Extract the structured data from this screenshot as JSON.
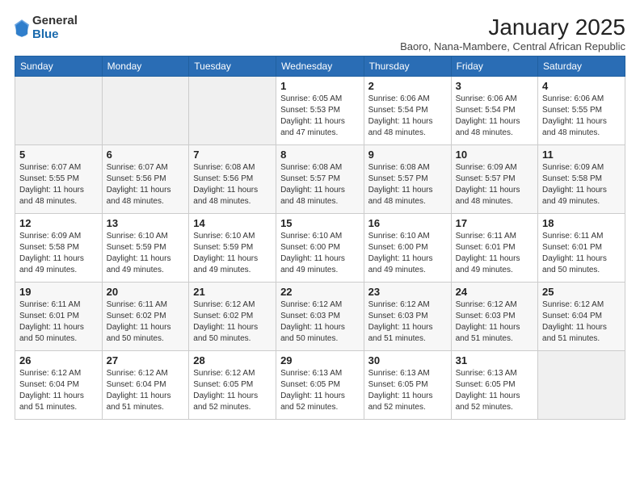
{
  "header": {
    "logo_general": "General",
    "logo_blue": "Blue",
    "month_title": "January 2025",
    "subtitle": "Baoro, Nana-Mambere, Central African Republic"
  },
  "days_of_week": [
    "Sunday",
    "Monday",
    "Tuesday",
    "Wednesday",
    "Thursday",
    "Friday",
    "Saturday"
  ],
  "weeks": [
    [
      {
        "day": "",
        "info": ""
      },
      {
        "day": "",
        "info": ""
      },
      {
        "day": "",
        "info": ""
      },
      {
        "day": "1",
        "info": "Sunrise: 6:05 AM\nSunset: 5:53 PM\nDaylight: 11 hours and 47 minutes."
      },
      {
        "day": "2",
        "info": "Sunrise: 6:06 AM\nSunset: 5:54 PM\nDaylight: 11 hours and 48 minutes."
      },
      {
        "day": "3",
        "info": "Sunrise: 6:06 AM\nSunset: 5:54 PM\nDaylight: 11 hours and 48 minutes."
      },
      {
        "day": "4",
        "info": "Sunrise: 6:06 AM\nSunset: 5:55 PM\nDaylight: 11 hours and 48 minutes."
      }
    ],
    [
      {
        "day": "5",
        "info": "Sunrise: 6:07 AM\nSunset: 5:55 PM\nDaylight: 11 hours and 48 minutes."
      },
      {
        "day": "6",
        "info": "Sunrise: 6:07 AM\nSunset: 5:56 PM\nDaylight: 11 hours and 48 minutes."
      },
      {
        "day": "7",
        "info": "Sunrise: 6:08 AM\nSunset: 5:56 PM\nDaylight: 11 hours and 48 minutes."
      },
      {
        "day": "8",
        "info": "Sunrise: 6:08 AM\nSunset: 5:57 PM\nDaylight: 11 hours and 48 minutes."
      },
      {
        "day": "9",
        "info": "Sunrise: 6:08 AM\nSunset: 5:57 PM\nDaylight: 11 hours and 48 minutes."
      },
      {
        "day": "10",
        "info": "Sunrise: 6:09 AM\nSunset: 5:57 PM\nDaylight: 11 hours and 48 minutes."
      },
      {
        "day": "11",
        "info": "Sunrise: 6:09 AM\nSunset: 5:58 PM\nDaylight: 11 hours and 49 minutes."
      }
    ],
    [
      {
        "day": "12",
        "info": "Sunrise: 6:09 AM\nSunset: 5:58 PM\nDaylight: 11 hours and 49 minutes."
      },
      {
        "day": "13",
        "info": "Sunrise: 6:10 AM\nSunset: 5:59 PM\nDaylight: 11 hours and 49 minutes."
      },
      {
        "day": "14",
        "info": "Sunrise: 6:10 AM\nSunset: 5:59 PM\nDaylight: 11 hours and 49 minutes."
      },
      {
        "day": "15",
        "info": "Sunrise: 6:10 AM\nSunset: 6:00 PM\nDaylight: 11 hours and 49 minutes."
      },
      {
        "day": "16",
        "info": "Sunrise: 6:10 AM\nSunset: 6:00 PM\nDaylight: 11 hours and 49 minutes."
      },
      {
        "day": "17",
        "info": "Sunrise: 6:11 AM\nSunset: 6:01 PM\nDaylight: 11 hours and 49 minutes."
      },
      {
        "day": "18",
        "info": "Sunrise: 6:11 AM\nSunset: 6:01 PM\nDaylight: 11 hours and 50 minutes."
      }
    ],
    [
      {
        "day": "19",
        "info": "Sunrise: 6:11 AM\nSunset: 6:01 PM\nDaylight: 11 hours and 50 minutes."
      },
      {
        "day": "20",
        "info": "Sunrise: 6:11 AM\nSunset: 6:02 PM\nDaylight: 11 hours and 50 minutes."
      },
      {
        "day": "21",
        "info": "Sunrise: 6:12 AM\nSunset: 6:02 PM\nDaylight: 11 hours and 50 minutes."
      },
      {
        "day": "22",
        "info": "Sunrise: 6:12 AM\nSunset: 6:03 PM\nDaylight: 11 hours and 50 minutes."
      },
      {
        "day": "23",
        "info": "Sunrise: 6:12 AM\nSunset: 6:03 PM\nDaylight: 11 hours and 51 minutes."
      },
      {
        "day": "24",
        "info": "Sunrise: 6:12 AM\nSunset: 6:03 PM\nDaylight: 11 hours and 51 minutes."
      },
      {
        "day": "25",
        "info": "Sunrise: 6:12 AM\nSunset: 6:04 PM\nDaylight: 11 hours and 51 minutes."
      }
    ],
    [
      {
        "day": "26",
        "info": "Sunrise: 6:12 AM\nSunset: 6:04 PM\nDaylight: 11 hours and 51 minutes."
      },
      {
        "day": "27",
        "info": "Sunrise: 6:12 AM\nSunset: 6:04 PM\nDaylight: 11 hours and 51 minutes."
      },
      {
        "day": "28",
        "info": "Sunrise: 6:12 AM\nSunset: 6:05 PM\nDaylight: 11 hours and 52 minutes."
      },
      {
        "day": "29",
        "info": "Sunrise: 6:13 AM\nSunset: 6:05 PM\nDaylight: 11 hours and 52 minutes."
      },
      {
        "day": "30",
        "info": "Sunrise: 6:13 AM\nSunset: 6:05 PM\nDaylight: 11 hours and 52 minutes."
      },
      {
        "day": "31",
        "info": "Sunrise: 6:13 AM\nSunset: 6:05 PM\nDaylight: 11 hours and 52 minutes."
      },
      {
        "day": "",
        "info": ""
      }
    ]
  ]
}
